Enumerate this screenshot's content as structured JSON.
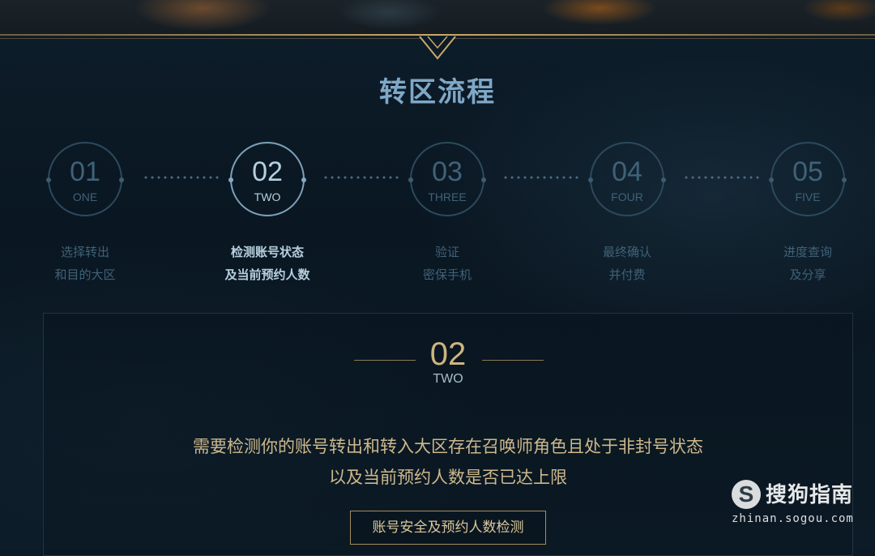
{
  "section_title": "转区流程",
  "steps": [
    {
      "num": "01",
      "word": "ONE",
      "caption_line1": "选择转出",
      "caption_line2": "和目的大区",
      "active": false
    },
    {
      "num": "02",
      "word": "TWO",
      "caption_line1": "检测账号状态",
      "caption_line2": "及当前预约人数",
      "active": true
    },
    {
      "num": "03",
      "word": "THREE",
      "caption_line1": "验证",
      "caption_line2": "密保手机",
      "active": false
    },
    {
      "num": "04",
      "word": "FOUR",
      "caption_line1": "最终确认",
      "caption_line2": "并付费",
      "active": false
    },
    {
      "num": "05",
      "word": "FIVE",
      "caption_line1": "进度查询",
      "caption_line2": "及分享",
      "active": false
    }
  ],
  "panel": {
    "num": "02",
    "word": "TWO",
    "desc_line1": "需要检测你的账号转出和转入大区存在召唤师角色且处于非封号状态",
    "desc_line2": "以及当前预约人数是否已达上限",
    "button_label": "账号安全及预约人数检测"
  },
  "watermark": {
    "logo": "S",
    "brand": "搜狗指南",
    "url": "zhinan.sogou.com"
  },
  "colors": {
    "accent_gold": "#c8a96a",
    "title_blue": "#7fa8c7",
    "active_step": "#b6cfdf",
    "inactive_step": "#3f6278",
    "background": "#0b1a26"
  }
}
